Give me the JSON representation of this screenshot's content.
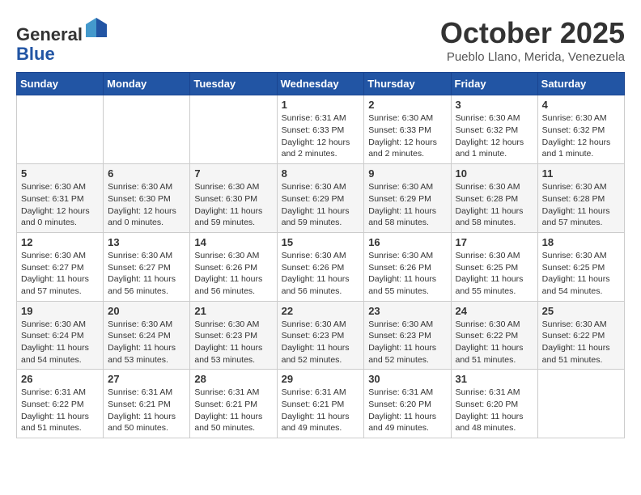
{
  "header": {
    "logo_general": "General",
    "logo_blue": "Blue",
    "month_title": "October 2025",
    "location": "Pueblo Llano, Merida, Venezuela"
  },
  "days_of_week": [
    "Sunday",
    "Monday",
    "Tuesday",
    "Wednesday",
    "Thursday",
    "Friday",
    "Saturday"
  ],
  "weeks": [
    [
      {
        "day": "",
        "info": ""
      },
      {
        "day": "",
        "info": ""
      },
      {
        "day": "",
        "info": ""
      },
      {
        "day": "1",
        "info": "Sunrise: 6:31 AM\nSunset: 6:33 PM\nDaylight: 12 hours\nand 2 minutes."
      },
      {
        "day": "2",
        "info": "Sunrise: 6:30 AM\nSunset: 6:33 PM\nDaylight: 12 hours\nand 2 minutes."
      },
      {
        "day": "3",
        "info": "Sunrise: 6:30 AM\nSunset: 6:32 PM\nDaylight: 12 hours\nand 1 minute."
      },
      {
        "day": "4",
        "info": "Sunrise: 6:30 AM\nSunset: 6:32 PM\nDaylight: 12 hours\nand 1 minute."
      }
    ],
    [
      {
        "day": "5",
        "info": "Sunrise: 6:30 AM\nSunset: 6:31 PM\nDaylight: 12 hours\nand 0 minutes."
      },
      {
        "day": "6",
        "info": "Sunrise: 6:30 AM\nSunset: 6:30 PM\nDaylight: 12 hours\nand 0 minutes."
      },
      {
        "day": "7",
        "info": "Sunrise: 6:30 AM\nSunset: 6:30 PM\nDaylight: 11 hours\nand 59 minutes."
      },
      {
        "day": "8",
        "info": "Sunrise: 6:30 AM\nSunset: 6:29 PM\nDaylight: 11 hours\nand 59 minutes."
      },
      {
        "day": "9",
        "info": "Sunrise: 6:30 AM\nSunset: 6:29 PM\nDaylight: 11 hours\nand 58 minutes."
      },
      {
        "day": "10",
        "info": "Sunrise: 6:30 AM\nSunset: 6:28 PM\nDaylight: 11 hours\nand 58 minutes."
      },
      {
        "day": "11",
        "info": "Sunrise: 6:30 AM\nSunset: 6:28 PM\nDaylight: 11 hours\nand 57 minutes."
      }
    ],
    [
      {
        "day": "12",
        "info": "Sunrise: 6:30 AM\nSunset: 6:27 PM\nDaylight: 11 hours\nand 57 minutes."
      },
      {
        "day": "13",
        "info": "Sunrise: 6:30 AM\nSunset: 6:27 PM\nDaylight: 11 hours\nand 56 minutes."
      },
      {
        "day": "14",
        "info": "Sunrise: 6:30 AM\nSunset: 6:26 PM\nDaylight: 11 hours\nand 56 minutes."
      },
      {
        "day": "15",
        "info": "Sunrise: 6:30 AM\nSunset: 6:26 PM\nDaylight: 11 hours\nand 56 minutes."
      },
      {
        "day": "16",
        "info": "Sunrise: 6:30 AM\nSunset: 6:26 PM\nDaylight: 11 hours\nand 55 minutes."
      },
      {
        "day": "17",
        "info": "Sunrise: 6:30 AM\nSunset: 6:25 PM\nDaylight: 11 hours\nand 55 minutes."
      },
      {
        "day": "18",
        "info": "Sunrise: 6:30 AM\nSunset: 6:25 PM\nDaylight: 11 hours\nand 54 minutes."
      }
    ],
    [
      {
        "day": "19",
        "info": "Sunrise: 6:30 AM\nSunset: 6:24 PM\nDaylight: 11 hours\nand 54 minutes."
      },
      {
        "day": "20",
        "info": "Sunrise: 6:30 AM\nSunset: 6:24 PM\nDaylight: 11 hours\nand 53 minutes."
      },
      {
        "day": "21",
        "info": "Sunrise: 6:30 AM\nSunset: 6:23 PM\nDaylight: 11 hours\nand 53 minutes."
      },
      {
        "day": "22",
        "info": "Sunrise: 6:30 AM\nSunset: 6:23 PM\nDaylight: 11 hours\nand 52 minutes."
      },
      {
        "day": "23",
        "info": "Sunrise: 6:30 AM\nSunset: 6:23 PM\nDaylight: 11 hours\nand 52 minutes."
      },
      {
        "day": "24",
        "info": "Sunrise: 6:30 AM\nSunset: 6:22 PM\nDaylight: 11 hours\nand 51 minutes."
      },
      {
        "day": "25",
        "info": "Sunrise: 6:30 AM\nSunset: 6:22 PM\nDaylight: 11 hours\nand 51 minutes."
      }
    ],
    [
      {
        "day": "26",
        "info": "Sunrise: 6:31 AM\nSunset: 6:22 PM\nDaylight: 11 hours\nand 51 minutes."
      },
      {
        "day": "27",
        "info": "Sunrise: 6:31 AM\nSunset: 6:21 PM\nDaylight: 11 hours\nand 50 minutes."
      },
      {
        "day": "28",
        "info": "Sunrise: 6:31 AM\nSunset: 6:21 PM\nDaylight: 11 hours\nand 50 minutes."
      },
      {
        "day": "29",
        "info": "Sunrise: 6:31 AM\nSunset: 6:21 PM\nDaylight: 11 hours\nand 49 minutes."
      },
      {
        "day": "30",
        "info": "Sunrise: 6:31 AM\nSunset: 6:20 PM\nDaylight: 11 hours\nand 49 minutes."
      },
      {
        "day": "31",
        "info": "Sunrise: 6:31 AM\nSunset: 6:20 PM\nDaylight: 11 hours\nand 48 minutes."
      },
      {
        "day": "",
        "info": ""
      }
    ]
  ]
}
